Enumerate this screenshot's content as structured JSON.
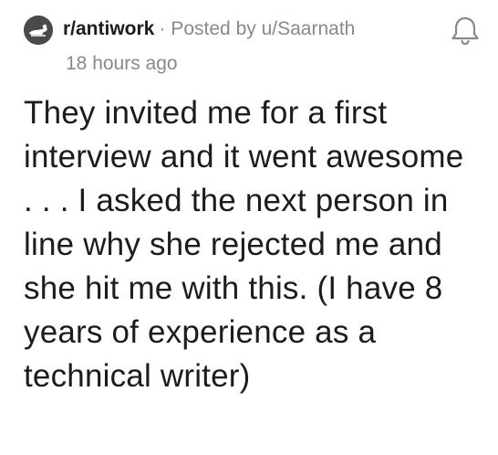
{
  "post": {
    "subreddit": "r/antiwork",
    "separator": "·",
    "posted_by": "Posted by u/Saarnath",
    "time_ago": "18 hours ago",
    "title": "They invited me for a first interview and it went awesome . . . I asked the next person in line why she rejected me and she hit me with this. (I have 8 years of experience as a technical writer)"
  },
  "icons": {
    "subreddit_avatar": "subreddit-avatar-icon",
    "notification": "bell-icon"
  },
  "colors": {
    "text_primary": "#1c1c1c",
    "text_meta": "#878a8c",
    "avatar_bg": "#4a4a4a",
    "background": "#ffffff"
  }
}
